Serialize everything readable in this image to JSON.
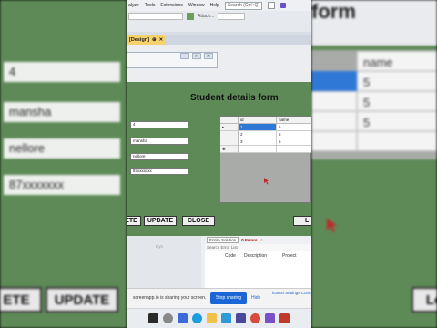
{
  "menu": {
    "items": [
      "alyze",
      "Tools",
      "Extensions",
      "Window",
      "Help"
    ],
    "search_placeholder": "Search (Ctrl+Q)"
  },
  "toolbar": {
    "attach_label": "Attach..."
  },
  "tab": {
    "label": "[Design]",
    "pin": "⊕",
    "close": "✕"
  },
  "form": {
    "title": "Student details form",
    "fields": [
      "4",
      "mansha",
      "nellore",
      "87xxxxxxx"
    ],
    "grid": {
      "columns": [
        "id",
        "name"
      ],
      "rows": [
        {
          "marker": "▸",
          "id": "1",
          "name": "5"
        },
        {
          "marker": "",
          "id": "2",
          "name": "5"
        },
        {
          "marker": "",
          "id": "3",
          "name": "5"
        },
        {
          "marker": "✱",
          "id": "",
          "name": ""
        }
      ]
    },
    "buttons": {
      "delete": "ETE",
      "update": "UPDATE",
      "close": "CLOSE",
      "load": "L"
    }
  },
  "background": {
    "title_fragment": "form",
    "column_name": "name",
    "fields": [
      "4",
      "mansha",
      "nellore",
      "87xxxxxxx"
    ],
    "grid_values": [
      "5",
      "5",
      "5"
    ],
    "buttons": {
      "delete": "ETE",
      "update": "UPDATE",
      "load": "Lo"
    }
  },
  "toolbox": {
    "label": "Dyn"
  },
  "error_list": {
    "scope": "Entire Solution",
    "errors": "0 Errors",
    "search": "Search Error List",
    "columns": [
      "Code",
      "Description",
      "Project"
    ]
  },
  "share_bar": {
    "text": "screenapp.io is sharing your screen.",
    "stop_label": "Stop sharing",
    "hide_label": "Hide",
    "right_text": "ication Settings  Conn"
  },
  "colors": {
    "form_green": "#5e8a58",
    "tab_yellow": "#f6d16c",
    "share_blue": "#1a66d6"
  }
}
